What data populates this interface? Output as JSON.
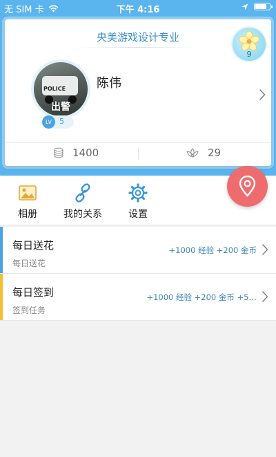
{
  "status_bar": {
    "carrier": "无 SIM 卡",
    "time": "下午 4:16",
    "battery_level": 0.8
  },
  "profile": {
    "school": "央美游戏设计专业",
    "name": "陈伟",
    "avatar_caption": "出警",
    "avatar_car_text": "POLICE",
    "level_prefix": "LV",
    "level": "5",
    "flower_count": "9",
    "coins": "1400",
    "flowers_received": "29"
  },
  "quick_menu": {
    "album": "相册",
    "relations": "我的关系",
    "settings": "设置"
  },
  "tasks": [
    {
      "title": "每日送花",
      "subtitle": "每日送花",
      "reward": "+1000 经验 +200 金币",
      "accent": "#4aa3e2"
    },
    {
      "title": "每日签到",
      "subtitle": "签到任务",
      "reward": "+1000 经验 +200 金币 +5…",
      "accent": "#f2c037"
    }
  ],
  "colors": {
    "header_blue": "#5ab4ee",
    "accent_red": "#ee6c6e",
    "link_blue": "#3a8ec8"
  },
  "icons": {
    "wifi": "wifi-icon",
    "location": "location-arrow-icon",
    "coins": "coins-icon",
    "flower": "lotus-icon",
    "fab": "map-pin-icon",
    "album": "photo-album-icon",
    "relations": "link-icon",
    "settings": "gear-icon"
  }
}
